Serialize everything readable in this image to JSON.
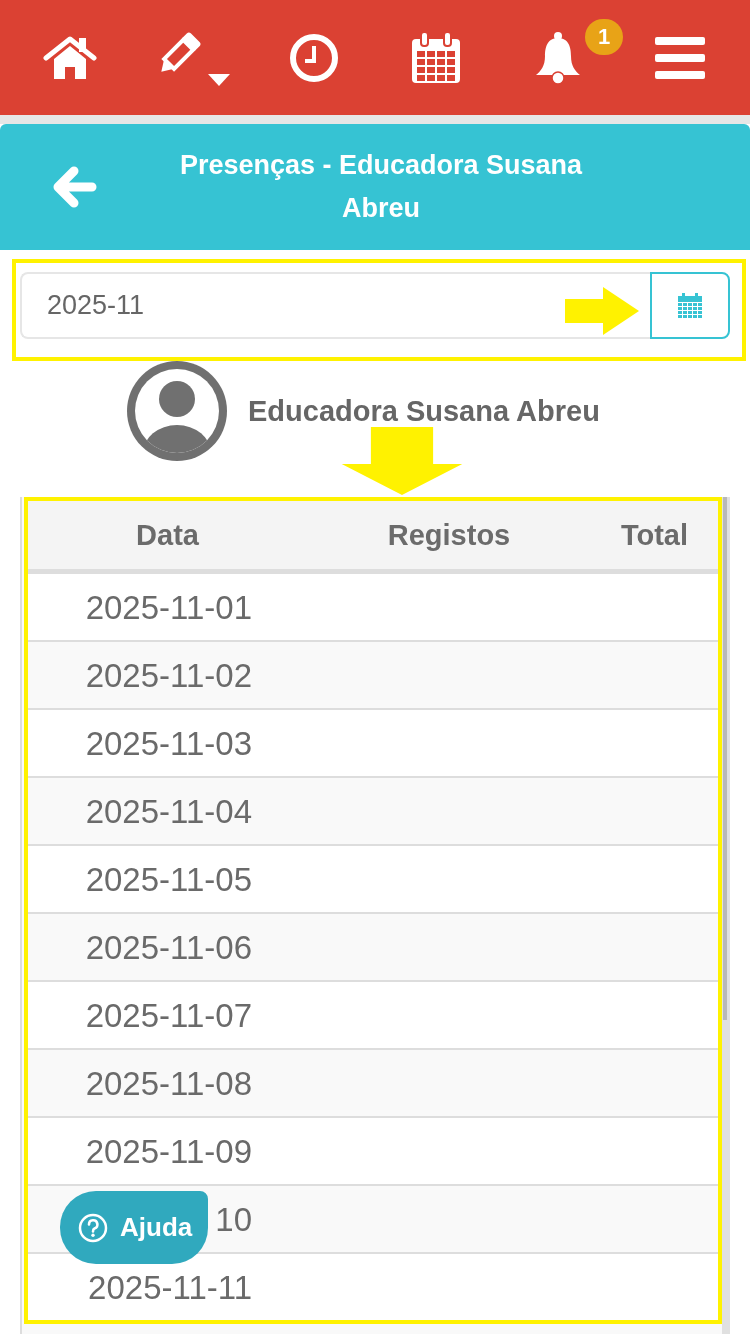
{
  "top_nav": {
    "notification_count": "1"
  },
  "header": {
    "title": "Presenças - Educadora Susana Abreu"
  },
  "month_picker": {
    "value": "2025-11"
  },
  "profile": {
    "name": "Educadora Susana Abreu"
  },
  "table": {
    "columns": [
      "Data",
      "Registos",
      "Total"
    ],
    "rows": [
      {
        "date": "2025-11-01"
      },
      {
        "date": "2025-11-02"
      },
      {
        "date": "2025-11-03"
      },
      {
        "date": "2025-11-04"
      },
      {
        "date": "2025-11-05"
      },
      {
        "date": "2025-11-06"
      },
      {
        "date": "2025-11-07"
      },
      {
        "date": "2025-11-08"
      },
      {
        "date": "2025-11-09"
      },
      {
        "date": "10"
      },
      {
        "date": "2025-11-11"
      }
    ]
  },
  "help_button": {
    "label": "Ajuda"
  }
}
